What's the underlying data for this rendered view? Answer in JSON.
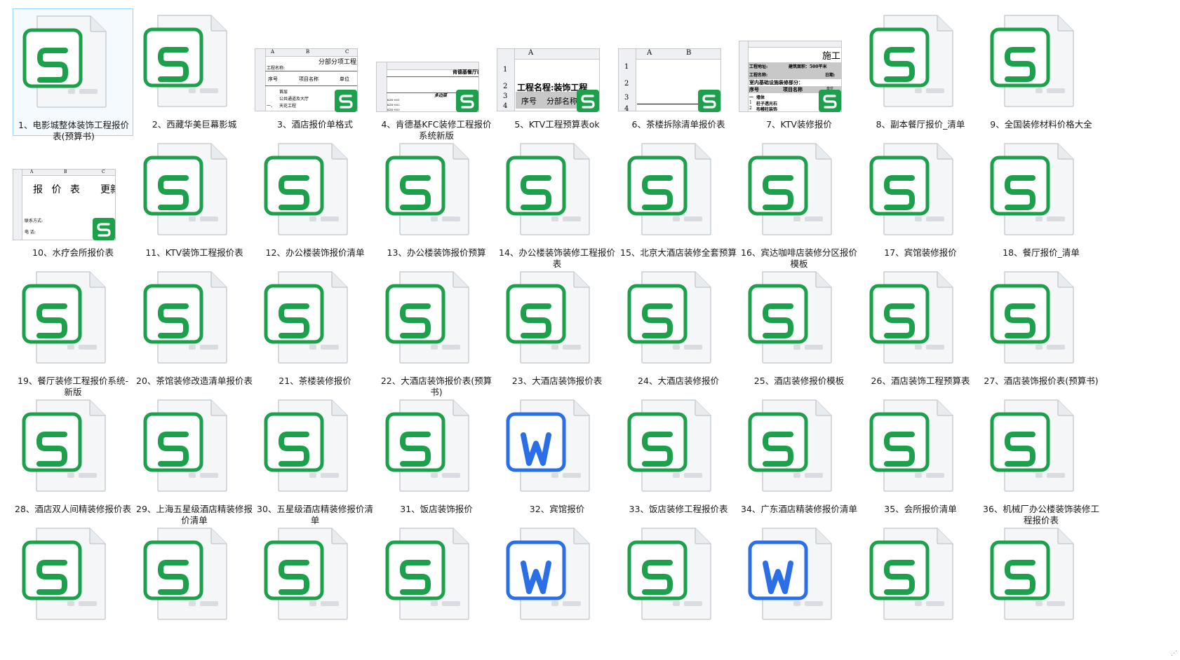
{
  "files": [
    {
      "label": "1、电影城整体装饰工程报价表(预算书)",
      "icon": "spreadsheet-icon",
      "selected": true
    },
    {
      "label": "2、西藏华美巨幕影城",
      "icon": "spreadsheet-icon"
    },
    {
      "label": "3、酒店报价单格式",
      "icon": "spreadsheet-preview",
      "preview": "p3"
    },
    {
      "label": "4、肯德基KFC装修工程报价系统新版",
      "icon": "spreadsheet-preview",
      "preview": "p4"
    },
    {
      "label": "5、KTV工程预算表ok",
      "icon": "spreadsheet-preview",
      "preview": "p5"
    },
    {
      "label": "6、茶楼拆除清单报价表",
      "icon": "spreadsheet-preview",
      "preview": "p6"
    },
    {
      "label": "7、KTV装修报价",
      "icon": "spreadsheet-preview",
      "preview": "p7"
    },
    {
      "label": "8、副本餐厅报价_清单",
      "icon": "spreadsheet-icon"
    },
    {
      "label": "9、全国装修材料价格大全",
      "icon": "spreadsheet-icon"
    },
    {
      "label": "10、水疗会所报价表",
      "icon": "spreadsheet-preview",
      "preview": "p10"
    },
    {
      "label": "11、KTV装饰工程报价表",
      "icon": "spreadsheet-icon"
    },
    {
      "label": "12、办公楼装饰报价清单",
      "icon": "spreadsheet-icon"
    },
    {
      "label": "13、办公楼装饰报价预算",
      "icon": "spreadsheet-icon"
    },
    {
      "label": "14、办公楼装饰装修工程报价表",
      "icon": "spreadsheet-icon"
    },
    {
      "label": "15、北京大酒店装修全套预算",
      "icon": "spreadsheet-icon"
    },
    {
      "label": "16、宾达咖啡店装修分区报价模板",
      "icon": "spreadsheet-icon"
    },
    {
      "label": "17、宾馆装修报价",
      "icon": "spreadsheet-icon"
    },
    {
      "label": "18、餐厅报价_清单",
      "icon": "spreadsheet-icon"
    },
    {
      "label": "19、餐厅装修工程报价系统-新版",
      "icon": "spreadsheet-icon"
    },
    {
      "label": "20、茶馆装修改造清单报价表",
      "icon": "spreadsheet-icon"
    },
    {
      "label": "21、茶楼装修报价",
      "icon": "spreadsheet-icon"
    },
    {
      "label": "22、大酒店装饰报价表(预算书)",
      "icon": "spreadsheet-icon"
    },
    {
      "label": "23、大酒店装饰报价表",
      "icon": "spreadsheet-icon"
    },
    {
      "label": "24、大酒店装修报价",
      "icon": "spreadsheet-icon"
    },
    {
      "label": "25、酒店装修报价模板",
      "icon": "spreadsheet-icon"
    },
    {
      "label": "26、酒店装饰工程预算表",
      "icon": "spreadsheet-icon"
    },
    {
      "label": "27、酒店装饰报价表(预算书)",
      "icon": "spreadsheet-icon"
    },
    {
      "label": "28、酒店双人间精装修报价表",
      "icon": "spreadsheet-icon"
    },
    {
      "label": "29、上海五星级酒店精装修报价清单",
      "icon": "spreadsheet-icon"
    },
    {
      "label": "30、五星级酒店精装修报价清单",
      "icon": "spreadsheet-icon"
    },
    {
      "label": "31、饭店装饰报价",
      "icon": "spreadsheet-icon"
    },
    {
      "label": "32、宾馆报价",
      "icon": "document-icon"
    },
    {
      "label": "33、饭店装修工程报价表",
      "icon": "spreadsheet-icon"
    },
    {
      "label": "34、广东酒店精装修报价清单",
      "icon": "spreadsheet-icon"
    },
    {
      "label": "35、会所报价清单",
      "icon": "spreadsheet-icon"
    },
    {
      "label": "36、机械厂办公楼装饰装修工程报价表",
      "icon": "spreadsheet-icon"
    },
    {
      "label": "",
      "icon": "spreadsheet-icon"
    },
    {
      "label": "",
      "icon": "spreadsheet-icon"
    },
    {
      "label": "",
      "icon": "spreadsheet-icon"
    },
    {
      "label": "",
      "icon": "spreadsheet-icon"
    },
    {
      "label": "",
      "icon": "document-icon"
    },
    {
      "label": "",
      "icon": "spreadsheet-icon"
    },
    {
      "label": "",
      "icon": "document-icon"
    },
    {
      "label": "",
      "icon": "spreadsheet-icon"
    },
    {
      "label": "",
      "icon": "spreadsheet-icon"
    }
  ],
  "previews": {
    "p3": {
      "col_a": "A",
      "col_b": "B",
      "col_c": "C",
      "title": "分部分项工程量",
      "r1": "工程名称:",
      "h1": "序号",
      "h2": "项目名称",
      "h3": "单位",
      "r4": "首层",
      "r5": "公共通道及大厅",
      "r6": "一、",
      "r6b": "天花工程"
    },
    "p4": {
      "title": "肯德基餐厅装",
      "sub": "多边菜",
      "c1": "KZS-001",
      "c2": "KZS-002",
      "c3": "KZS-003"
    },
    "p5": {
      "col_a": "A",
      "row1": "1",
      "row2": "2",
      "row3": "3",
      "row4": "4",
      "title": "工程名程:装饰工程",
      "h1": "序号",
      "h2": "分部名称"
    },
    "p6": {
      "col_a": "A",
      "col_b": "B",
      "row1": "1",
      "row2": "2",
      "row3": "3",
      "row4": "4"
    },
    "p7": {
      "title": "施工",
      "r1a": "工程地址:",
      "r1b": "建筑面积：500平米",
      "r2a": "工程名称:",
      "r2b": "日期:",
      "r3": "室内基础设施装修部分：",
      "h1": "序号",
      "h2": "项目名称",
      "h3": "单位",
      "r5": "一",
      "r5b": "墙体",
      "r6": "1",
      "r6b": "柱子透光石",
      "r7": "2",
      "r7b": "布幔柱装饰"
    },
    "p10": {
      "col_a": "A",
      "col_b": "B",
      "col_c": "C",
      "title": "报 价 表",
      "title2": "更新",
      "r3": "联系方式:",
      "r4": "电    话:"
    }
  },
  "colors": {
    "spreadsheet": "#1ca04b",
    "document": "#2b6fe8",
    "selection_border": "#99d1ff"
  }
}
